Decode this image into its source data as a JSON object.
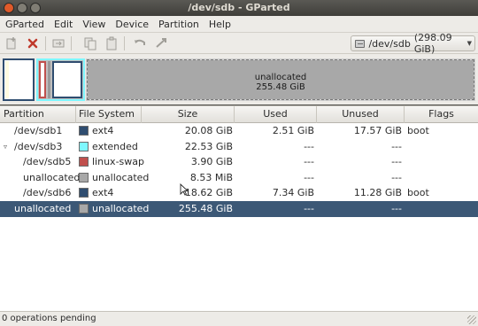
{
  "window": {
    "title": "/dev/sdb - GParted"
  },
  "menubar": {
    "items": [
      "GParted",
      "Edit",
      "View",
      "Device",
      "Partition",
      "Help"
    ]
  },
  "toolbar": {
    "buttons": [
      {
        "icon": "new-partition-icon",
        "enabled": false
      },
      {
        "icon": "delete-icon",
        "enabled": true
      },
      {
        "icon": "resize-move-icon",
        "enabled": false
      },
      {
        "icon": "copy-icon",
        "enabled": false
      },
      {
        "icon": "paste-icon",
        "enabled": false
      },
      {
        "icon": "undo-icon",
        "enabled": false
      },
      {
        "icon": "apply-icon",
        "enabled": false
      }
    ],
    "device": {
      "name": "/dev/sdb",
      "size": "(298.09 GiB)"
    }
  },
  "graphic": {
    "unallocated_label": "unallocated",
    "unallocated_size": "255.48 GiB"
  },
  "colors": {
    "ext4": "#2f4d70",
    "extended": "#7ff7ff",
    "linux-swap": "#c0504d",
    "unallocated": "#a8a8a8",
    "selection": "#3c5876"
  },
  "table": {
    "headers": [
      "Partition",
      "File System",
      "Size",
      "Used",
      "Unused",
      "Flags"
    ],
    "rows": [
      {
        "partition": "/dev/sdb1",
        "fs": "ext4",
        "fs_color": "#2f4d70",
        "size": "20.08 GiB",
        "used": "2.51 GiB",
        "unused": "17.57 GiB",
        "flags": "boot",
        "indent": 1,
        "expander": "",
        "selected": false
      },
      {
        "partition": "/dev/sdb3",
        "fs": "extended",
        "fs_color": "#7ff7ff",
        "size": "22.53 GiB",
        "used": "---",
        "unused": "---",
        "flags": "",
        "indent": 1,
        "expander": "▿",
        "selected": false
      },
      {
        "partition": "/dev/sdb5",
        "fs": "linux-swap",
        "fs_color": "#c0504d",
        "size": "3.90 GiB",
        "used": "---",
        "unused": "---",
        "flags": "",
        "indent": 2,
        "expander": "",
        "selected": false
      },
      {
        "partition": "unallocated",
        "fs": "unallocated",
        "fs_color": "#a8a8a8",
        "size": "8.53 MiB",
        "used": "---",
        "unused": "---",
        "flags": "",
        "indent": 2,
        "expander": "",
        "selected": false
      },
      {
        "partition": "/dev/sdb6",
        "fs": "ext4",
        "fs_color": "#2f4d70",
        "size": "18.62 GiB",
        "used": "7.34 GiB",
        "unused": "11.28 GiB",
        "flags": "boot",
        "indent": 2,
        "expander": "",
        "selected": false
      },
      {
        "partition": "unallocated",
        "fs": "unallocated",
        "fs_color": "#a8a8a8",
        "size": "255.48 GiB",
        "used": "---",
        "unused": "---",
        "flags": "",
        "indent": 1,
        "expander": "",
        "selected": true
      }
    ]
  },
  "statusbar": {
    "text": "0 operations pending"
  }
}
